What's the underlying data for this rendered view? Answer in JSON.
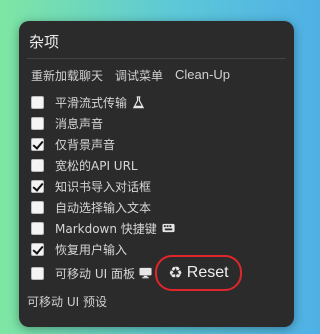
{
  "panel": {
    "title": "杂项"
  },
  "toolbar": {
    "items": [
      "重新加载聊天",
      "调试菜单",
      "Clean-Up"
    ]
  },
  "options": [
    {
      "label": "平滑流式传输",
      "checked": false,
      "icon": "flask-icon"
    },
    {
      "label": "消息声音",
      "checked": false
    },
    {
      "label": "仅背景声音",
      "checked": true
    },
    {
      "label": "宽松的API URL",
      "checked": false
    },
    {
      "label": "知识书导入对话框",
      "checked": true
    },
    {
      "label": "自动选择输入文本",
      "checked": false
    },
    {
      "label": "Markdown 快捷键",
      "checked": false,
      "icon": "keyboard-icon"
    },
    {
      "label": "恢复用户输入",
      "checked": true
    },
    {
      "label": "可移动 UI 面板",
      "checked": false,
      "icon": "monitor-icon"
    }
  ],
  "reset": {
    "label": "Reset",
    "icon": "recycle-icon"
  },
  "presets": {
    "label": "可移动 UI 预设"
  },
  "colors": {
    "panel_bg": "#2b2b2b",
    "highlight_ring": "#e0262b"
  }
}
